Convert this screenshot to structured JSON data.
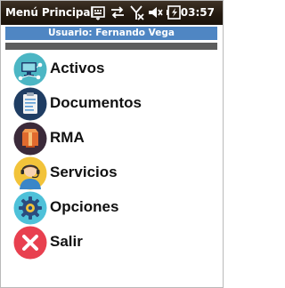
{
  "window": {
    "title": "Menú Principal",
    "clock": "03:57"
  },
  "status_icons": [
    "keyboard-icon",
    "sync-icon",
    "no-signal-icon",
    "volume-muted-icon",
    "battery-charging-icon"
  ],
  "user_bar": {
    "text": "Usuario: Fernando Vega",
    "color": "#4f86c3"
  },
  "menu": {
    "items": [
      {
        "label": "Activos",
        "icon": "computer-network-icon"
      },
      {
        "label": "Documentos",
        "icon": "clipboard-icon"
      },
      {
        "label": "RMA",
        "icon": "box-icon"
      },
      {
        "label": "Servicios",
        "icon": "support-agent-icon"
      },
      {
        "label": "Opciones",
        "icon": "gear-icon"
      },
      {
        "label": "Salir",
        "icon": "close-icon"
      }
    ]
  }
}
